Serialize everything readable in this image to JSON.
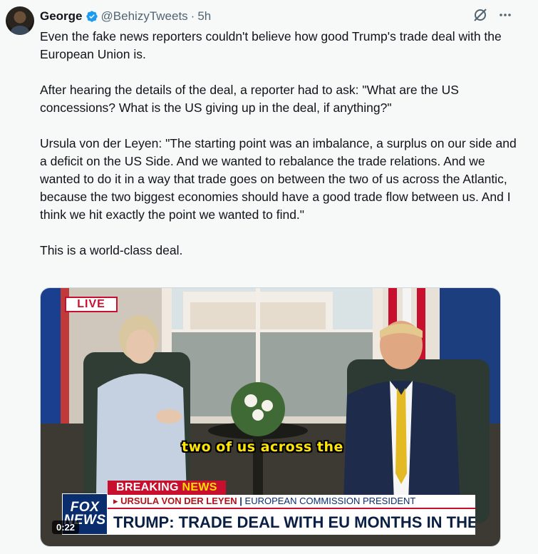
{
  "author": {
    "display_name": "George",
    "handle": "@BehizyTweets",
    "separator": "·",
    "time": "5h"
  },
  "icons": {
    "verified": "verified-badge-icon",
    "grok": "grok-icon",
    "more": "more-icon"
  },
  "colors": {
    "verified_blue": "#1d9bf0",
    "text": "#0f1419",
    "secondary_text": "#536471",
    "fox_red": "#c8102e",
    "fox_navy": "#0a2d6e",
    "caption_yellow": "#ffe500"
  },
  "tweet": {
    "paragraphs": [
      "Even the fake news reporters couldn't believe how good Trump's trade deal with the European Union is.",
      "After hearing the details of the deal, a reporter had to ask: \"What are the US concessions? What is the US giving up in the deal, if anything?\"",
      "Ursula von der Leyen: \"The starting point was an imbalance, a surplus on our side and a deficit on the US Side. And we wanted to rebalance the trade relations. And we wanted to do it in a way that trade goes on between the two of us across the Atlantic, because the two biggest economies should have a good trade flow between us. And I think we hit exactly the point we wanted to find.\"",
      "This is a world-class deal."
    ]
  },
  "video": {
    "live_label": "LIVE",
    "caption": "two of us across the",
    "breaking_label_1": "BREAKING",
    "breaking_label_2": "NEWS",
    "name_marker": "▸",
    "speaker_name": "URSULA VON DER LEYEN",
    "name_separator": "|",
    "speaker_role": "EUROPEAN COMMISSION PRESIDENT",
    "headline": "TRUMP: TRADE DEAL WITH EU MONTHS IN THE MAKING",
    "logo_line_1": "FOX",
    "logo_line_2": "NEWS",
    "time_elapsed": "0:22"
  }
}
